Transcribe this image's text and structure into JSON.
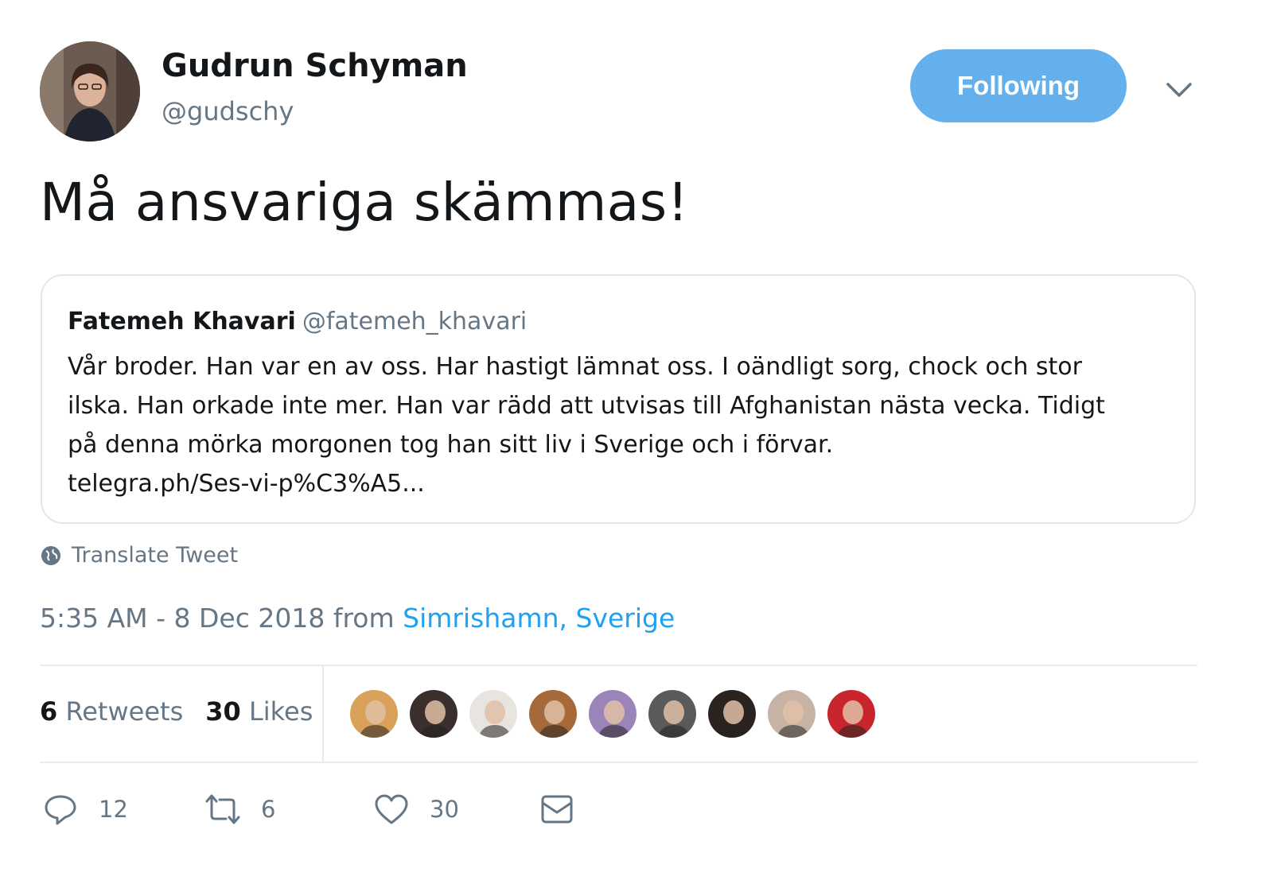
{
  "author": {
    "name": "Gudrun Schyman",
    "handle": "@gudschy",
    "avatar_icon": "profile-photo"
  },
  "follow_button": {
    "label": "Following",
    "color": "#63b0ec"
  },
  "menu_icon": "chevron-down-icon",
  "tweet": {
    "text": "Må ansvariga skämmas!"
  },
  "quoted_tweet": {
    "name": "Fatemeh Khavari",
    "handle": "@fatemeh_khavari",
    "lines": [
      "Vår broder. Han var en av oss. Har hastigt lämnat oss. I oändligt sorg, chock och stor",
      "ilska. Han orkade inte mer. Han var rädd att utvisas till Afghanistan nästa vecka. Tidigt",
      "på denna mörka morgonen tog han sitt liv i Sverige och i förvar.",
      "telegra.ph/Ses-vi-p%C3%A5..."
    ]
  },
  "translate": {
    "label": "Translate Tweet",
    "icon": "globe-icon"
  },
  "meta": {
    "timestamp": "5:35 AM - 8 Dec 2018 from ",
    "location": "Simrishamn, Sverige"
  },
  "stats": {
    "retweets_count": "6",
    "retweets_label": "Retweets",
    "likes_count": "30",
    "likes_label": "Likes"
  },
  "likers": [
    {
      "icon": "avatar-1",
      "color": "#d9a15a"
    },
    {
      "icon": "avatar-2",
      "color": "#3a2f2c"
    },
    {
      "icon": "avatar-3",
      "color": "#e8e4e0"
    },
    {
      "icon": "avatar-4",
      "color": "#a66a3a"
    },
    {
      "icon": "avatar-5",
      "color": "#9b84b8"
    },
    {
      "icon": "avatar-6",
      "color": "#5a5a5a"
    },
    {
      "icon": "avatar-7",
      "color": "#2b2320"
    },
    {
      "icon": "avatar-8",
      "color": "#c7b3a5"
    },
    {
      "icon": "avatar-9",
      "color": "#c8262c"
    }
  ],
  "actions": {
    "reply_count": "12",
    "retweet_count": "6",
    "like_count": "30",
    "reply_icon": "reply-icon",
    "retweet_icon": "retweet-icon",
    "like_icon": "heart-icon",
    "dm_icon": "envelope-icon"
  },
  "colors": {
    "text": "#14171a",
    "secondary": "#657786",
    "link": "#1da1f2",
    "border": "#e1e8ed"
  }
}
